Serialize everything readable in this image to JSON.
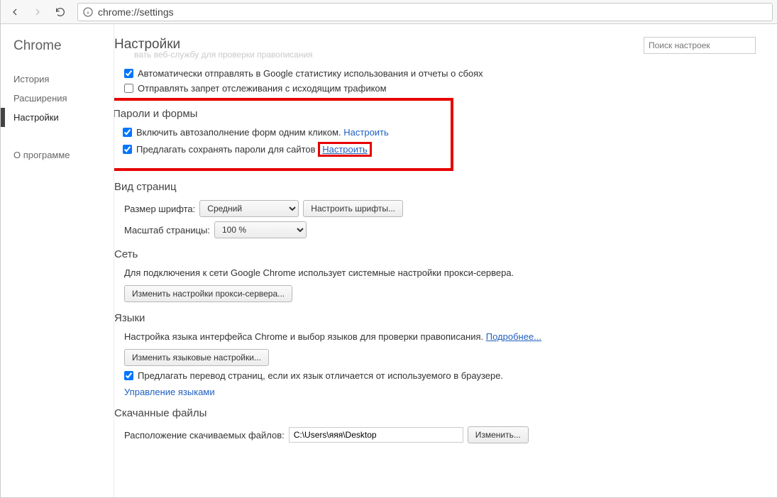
{
  "browser": {
    "url": "chrome://settings"
  },
  "sidebar": {
    "brand": "Chrome",
    "items": [
      {
        "label": "История",
        "active": false
      },
      {
        "label": "Расширения",
        "active": false
      },
      {
        "label": "Настройки",
        "active": true
      }
    ],
    "about": "О программе"
  },
  "header": {
    "title": "Настройки",
    "search_placeholder": "Поиск настроек"
  },
  "faded_text": "вать веб-службу для проверки правописания",
  "privacy": {
    "opt1": {
      "label": "Автоматически отправлять в Google статистику использования и отчеты о сбоях",
      "checked": true
    },
    "opt2": {
      "label": "Отправлять запрет отслеживания с исходящим трафиком",
      "checked": false
    }
  },
  "passwords": {
    "title": "Пароли и формы",
    "opt1": {
      "label": "Включить автозаполнение форм одним кликом.",
      "link": "Настроить",
      "checked": true
    },
    "opt2": {
      "label": "Предлагать сохранять пароли для сайтов",
      "link": "Настроить",
      "checked": true
    }
  },
  "appearance": {
    "title": "Вид страниц",
    "font_label": "Размер шрифта:",
    "font_value": "Средний",
    "font_button": "Настроить шрифты...",
    "zoom_label": "Масштаб страницы:",
    "zoom_value": "100 %"
  },
  "network": {
    "title": "Сеть",
    "description": "Для подключения к сети Google Chrome использует системные настройки прокси-сервера.",
    "button": "Изменить настройки прокси-сервера..."
  },
  "languages": {
    "title": "Языки",
    "description": "Настройка языка интерфейса Chrome и выбор языков для проверки правописания.",
    "desc_link": "Подробнее...",
    "button": "Изменить языковые настройки...",
    "translate": {
      "label": "Предлагать перевод страниц, если их язык отличается от используемого в браузере.",
      "checked": true
    },
    "manage_link": "Управление языками"
  },
  "downloads": {
    "title": "Скачанные файлы",
    "location_label": "Расположение скачиваемых файлов:",
    "location_value": "C:\\Users\\яяя\\Desktop",
    "change_button": "Изменить..."
  }
}
